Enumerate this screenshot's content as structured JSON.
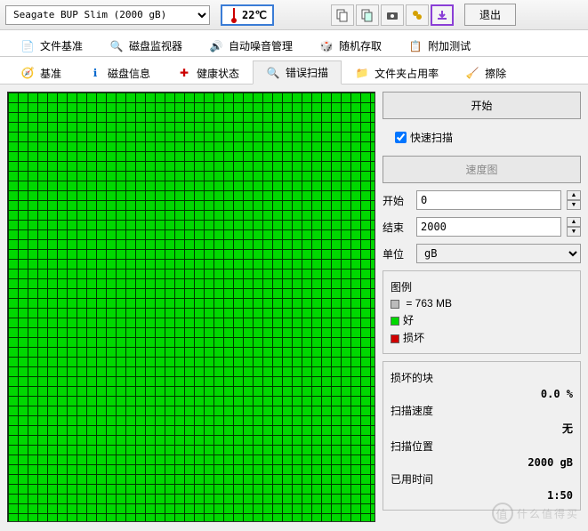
{
  "top": {
    "drive": "Seagate BUP Slim (2000 gB)",
    "temp": "22℃",
    "exit": "退出"
  },
  "tabs": {
    "file_benchmark": "文件基准",
    "disk_monitor": "磁盘监视器",
    "aam": "自动噪音管理",
    "random_access": "随机存取",
    "extra_tests": "附加测试",
    "benchmark": "基准",
    "disk_info": "磁盘信息",
    "health": "健康状态",
    "error_scan": "错误扫描",
    "folder_usage": "文件夹占用率",
    "erase": "擦除"
  },
  "side": {
    "start_btn": "开始",
    "quick_scan": "快速扫描",
    "speed_map": "速度图",
    "start_label": "开始",
    "start_val": "0",
    "end_label": "结束",
    "end_val": "2000",
    "unit_label": "单位",
    "unit_val": "gB"
  },
  "legend": {
    "title": "图例",
    "block_size": " = 763 MB",
    "good": "好",
    "bad": "损坏"
  },
  "stats": {
    "damaged_label": "损坏的块",
    "damaged_val": "0.0 %",
    "speed_label": "扫描速度",
    "speed_val": "无",
    "pos_label": "扫描位置",
    "pos_val": "2000 gB",
    "elapsed_label": "已用时间",
    "elapsed_val": "1:50"
  },
  "watermark": {
    "char": "值",
    "text": "什么值得买"
  }
}
